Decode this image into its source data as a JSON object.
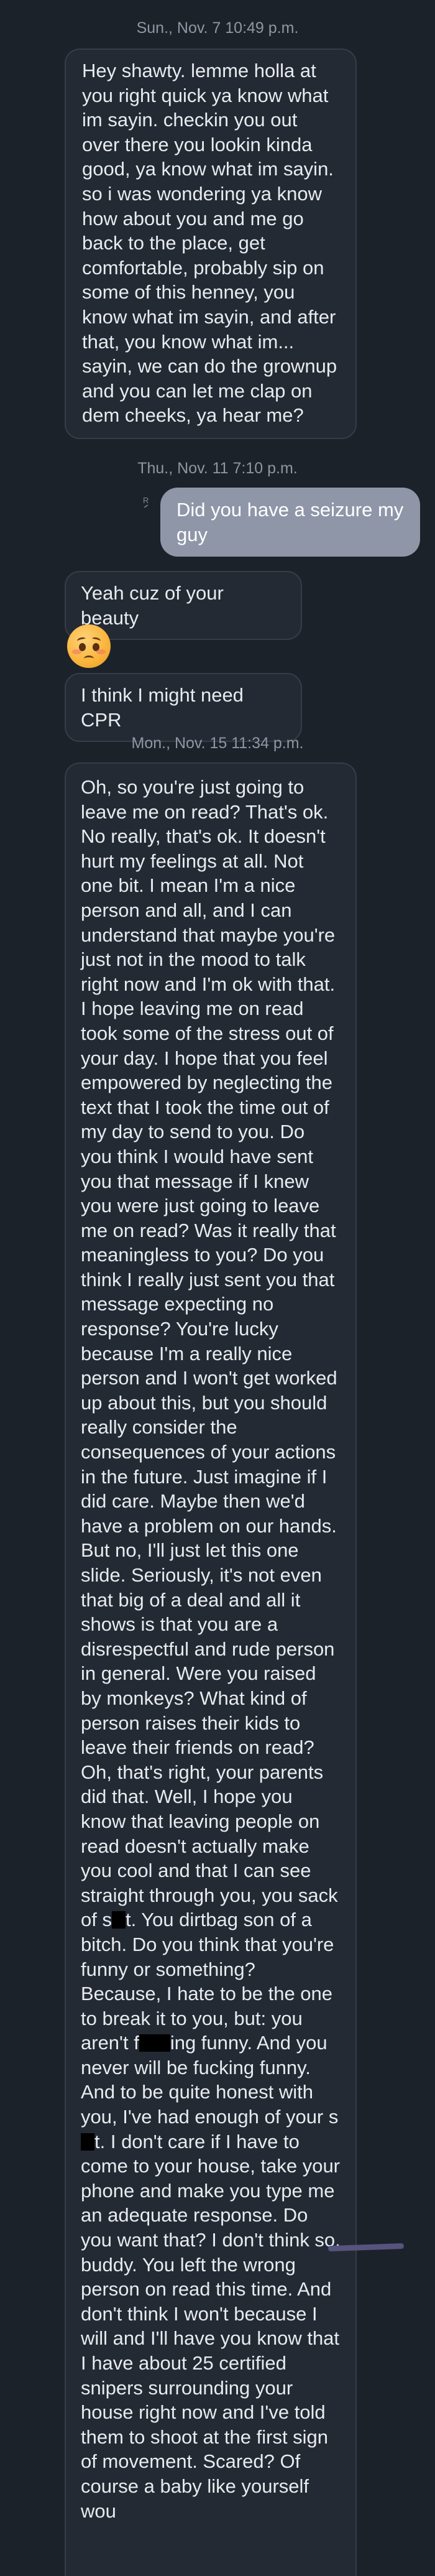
{
  "timestamps": {
    "t1": "Sun., Nov. 7 10:49 p.m.",
    "t2": "Thu., Nov. 11 7:10 p.m.",
    "t3": "Mon., Nov. 15 11:34 p.m."
  },
  "messages": {
    "m1": "Hey shawty. lemme holla at you right quick ya know what im sayin. checkin you out over there you lookin kinda good, ya know what im sayin. so i was wondering ya know how about you and me go back to the place, get comfortable, probably sip on some of this henney, you know what im sayin, and after that, you know what im... sayin, we can do the grownup and you can let me clap on dem cheeks, ya hear me?",
    "m2": "Did you have a seizure my guy",
    "m3": "Yeah cuz of your beauty",
    "m4": "I think I might need CPR",
    "m5_part1": "Oh, so you're just going to leave me on read? That's ok. No really, that's ok. It doesn't hurt my feelings at all. Not one bit. I mean I'm a nice person and all, and I can understand that maybe you're just not in the mood to talk right now and I'm ok with that. I hope leaving me on read took some of the stress out of your day. I hope that you feel empowered by neglecting the text that I took the time out of my day to send to you. Do you think I would have sent you that message if I knew you were just going to leave me on read? Was it really that meaningless to you? Do you think I really just sent you that message expecting no response? You're lucky because I'm a really nice person and I won't get worked up about this, but you should really consider the consequences of your actions in the future. Just imagine if I did care. Maybe then we'd have a problem on our hands. But no, I'll just let this one slide. Seriously, it's not even that big of a deal and all it shows is that you are a disrespectful and rude person in general. Were you raised by monkeys? What kind of person raises their kids to leave their friends on read? Oh, that's right, your parents did that. Well, I hope you know that leaving people on read doesn't actually make you cool and that I can see straight through you, you sack of s",
    "m5_part2": "t. You dirtbag son of a bitch. Do you think that you're funny or something? Because, I hate to be the one to break it to you, but: you aren't f",
    "m5_part3": "ing funny. And you never will be fucking funny. And to be quite honest with you, I've had enough of your s",
    "m5_part4": "t. I don't care if I have to come to your house, take your phone and make you type me an adequate response. Do you want that? I don't think so, buddy. You left the wrong person on read this time. And don't think I won't because I will and I'll have you know that I have about 25 certified snipers surrounding your house right now and I've told them to shoot at the first sign of movement. Scared? Of course a baby like yourself wou"
  },
  "icons": {
    "read_receipt": "read-receipt-icon",
    "emoji": "flushed-face-emoji"
  },
  "colors": {
    "background": "#1c222a",
    "incoming_bubble": "#232a33",
    "outgoing_bubble": "#8f96a8"
  }
}
